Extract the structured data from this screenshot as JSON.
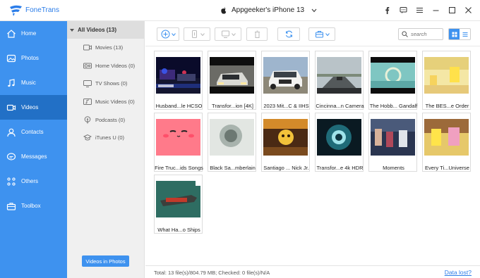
{
  "app": {
    "name": "FoneTrans",
    "device_name": "Appgeeker's iPhone 13",
    "accent_color": "#3e92ef",
    "active_nav_color": "#2270c6"
  },
  "sidebar": {
    "items": [
      {
        "label": "Home",
        "icon": "home-icon"
      },
      {
        "label": "Photos",
        "icon": "photos-icon"
      },
      {
        "label": "Music",
        "icon": "music-icon"
      },
      {
        "label": "Videos",
        "icon": "video-icon",
        "active": true
      },
      {
        "label": "Contacts",
        "icon": "contacts-icon"
      },
      {
        "label": "Messages",
        "icon": "messages-icon"
      },
      {
        "label": "Others",
        "icon": "others-icon"
      },
      {
        "label": "Toolbox",
        "icon": "toolbox-icon"
      }
    ]
  },
  "categories": {
    "header": "All Videos (13)",
    "items": [
      {
        "label": "Movies (13)",
        "icon": "movie-icon"
      },
      {
        "label": "Home Videos (0)",
        "icon": "home-video-icon"
      },
      {
        "label": "TV Shows (0)",
        "icon": "tv-icon"
      },
      {
        "label": "Music Videos (0)",
        "icon": "music-video-icon"
      },
      {
        "label": "Podcasts (0)",
        "icon": "podcast-icon"
      },
      {
        "label": "iTunes U (0)",
        "icon": "itunes-u-icon"
      }
    ],
    "videos_in_photos_button": "Videos in Photos"
  },
  "toolbar": {
    "search_placeholder": "search"
  },
  "videos": [
    {
      "title": "Husband...le HCSO"
    },
    {
      "title": "Transfor...ion [4K]"
    },
    {
      "title": "2023 Mit...C & IIHS"
    },
    {
      "title": "Cincinna...n Camera"
    },
    {
      "title": "The Hobb... Gandalf"
    },
    {
      "title": "The BES...e Order"
    },
    {
      "title": "Fire Truc...ids Songs"
    },
    {
      "title": "Black Sa...mberlain"
    },
    {
      "title": "Santiago ... Nick Jr."
    },
    {
      "title": "Transfor...e 4k HDR"
    },
    {
      "title": "Moments"
    },
    {
      "title": "Every Ti...Universe"
    },
    {
      "title": "What Ha...o Ships"
    }
  ],
  "status": {
    "summary": "Total: 13 file(s)/804.79 MB; Checked: 0 file(s)/N/A",
    "data_lost": "Data lost?"
  }
}
